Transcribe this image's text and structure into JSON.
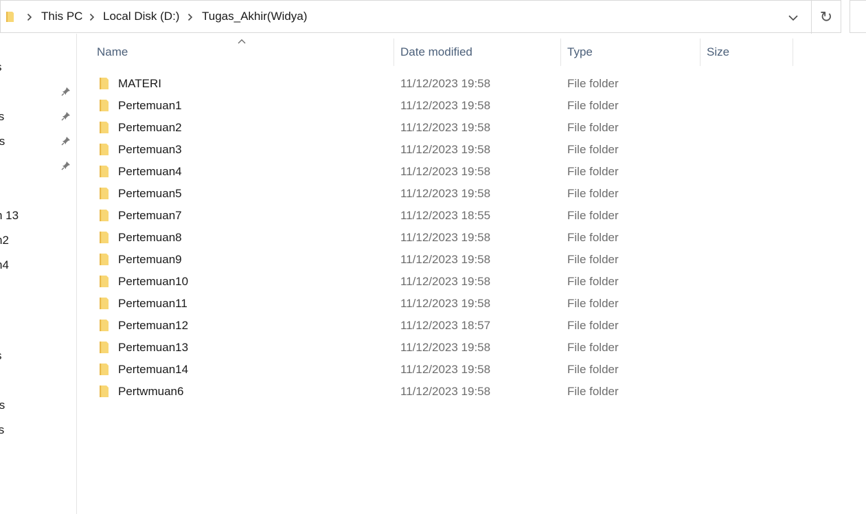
{
  "address_bar": {
    "crumbs": [
      "This PC",
      "Local Disk (D:)",
      "Tugas_Akhir(Widya)"
    ]
  },
  "nav_pane": {
    "items": [
      "s",
      "ls",
      "ts",
      "n 13",
      "n2",
      "n4",
      "s",
      "ts",
      "ls"
    ]
  },
  "columns": {
    "name": "Name",
    "date_modified": "Date modified",
    "type": "Type",
    "size": "Size"
  },
  "files": [
    {
      "name": "MATERI",
      "date": "11/12/2023 19:58",
      "type": "File folder"
    },
    {
      "name": "Pertemuan1",
      "date": "11/12/2023 19:58",
      "type": "File folder"
    },
    {
      "name": "Pertemuan2",
      "date": "11/12/2023 19:58",
      "type": "File folder"
    },
    {
      "name": "Pertemuan3",
      "date": "11/12/2023 19:58",
      "type": "File folder"
    },
    {
      "name": "Pertemuan4",
      "date": "11/12/2023 19:58",
      "type": "File folder"
    },
    {
      "name": "Pertemuan5",
      "date": "11/12/2023 19:58",
      "type": "File folder"
    },
    {
      "name": "Pertemuan7",
      "date": "11/12/2023 18:55",
      "type": "File folder"
    },
    {
      "name": "Pertemuan8",
      "date": "11/12/2023 19:58",
      "type": "File folder"
    },
    {
      "name": "Pertemuan9",
      "date": "11/12/2023 19:58",
      "type": "File folder"
    },
    {
      "name": "Pertemuan10",
      "date": "11/12/2023 19:58",
      "type": "File folder"
    },
    {
      "name": "Pertemuan11",
      "date": "11/12/2023 19:58",
      "type": "File folder"
    },
    {
      "name": "Pertemuan12",
      "date": "11/12/2023 18:57",
      "type": "File folder"
    },
    {
      "name": "Pertemuan13",
      "date": "11/12/2023 19:58",
      "type": "File folder"
    },
    {
      "name": "Pertemuan14",
      "date": "11/12/2023 19:58",
      "type": "File folder"
    },
    {
      "name": "Pertwmuan6",
      "date": "11/12/2023 19:58",
      "type": "File folder"
    }
  ],
  "colors": {
    "folder_yellow": "#f8d775",
    "folder_shade": "#e9b949",
    "header_text": "#4c607a",
    "secondary_text": "#6d6d6d",
    "divider": "#e5e5e5"
  }
}
